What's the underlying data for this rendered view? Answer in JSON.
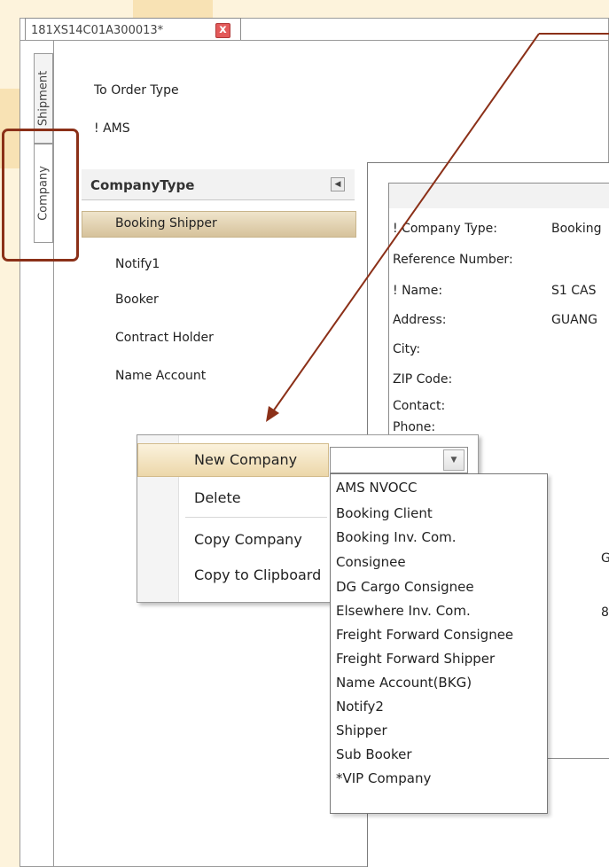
{
  "document_tab": {
    "title": "181XS14C01A300013*",
    "close_glyph": "x"
  },
  "side_tabs": {
    "shipment": "Shipment",
    "company": "Company"
  },
  "header_fields": {
    "to_order_type": "To Order Type",
    "ams": "! AMS"
  },
  "company_type_panel": {
    "title": "CompanyType",
    "collapse_glyph": "◀",
    "items": [
      "Booking Shipper",
      "Notify1",
      "Booker",
      "Contract Holder",
      "Name Account"
    ],
    "selected": "Booking Shipper"
  },
  "properties": {
    "labels": [
      "! Company Type:",
      "Reference Number:",
      "! Name:",
      "Address:",
      "City:",
      "ZIP Code:",
      "Contact:",
      "Phone:"
    ],
    "values": [
      "Booking",
      "",
      "S1 CAS",
      "GUANG",
      "",
      "",
      "",
      ""
    ]
  },
  "context_menu": {
    "items": [
      "New Company",
      "Delete",
      "Copy Company",
      "Copy to Clipboard"
    ],
    "hovered": "New Company",
    "combo_value": "",
    "combo_arrow": "▼"
  },
  "dropdown": {
    "options": [
      "AMS NVOCC",
      "Booking Client",
      "Booking Inv. Com.",
      "Consignee",
      "DG Cargo Consignee",
      "Elsewhere Inv. Com.",
      "Freight Forward Consignee",
      "Freight Forward Shipper",
      "Name Account(BKG)",
      "Notify2",
      "Shipper",
      "Sub Booker",
      "*VIP Company"
    ]
  },
  "hidden_partial_text": {
    "row1": "G",
    "row2": "8"
  },
  "colors": {
    "annotation": "#8b3018",
    "selection": "#d6c29b",
    "background": "#fdf3dc"
  }
}
